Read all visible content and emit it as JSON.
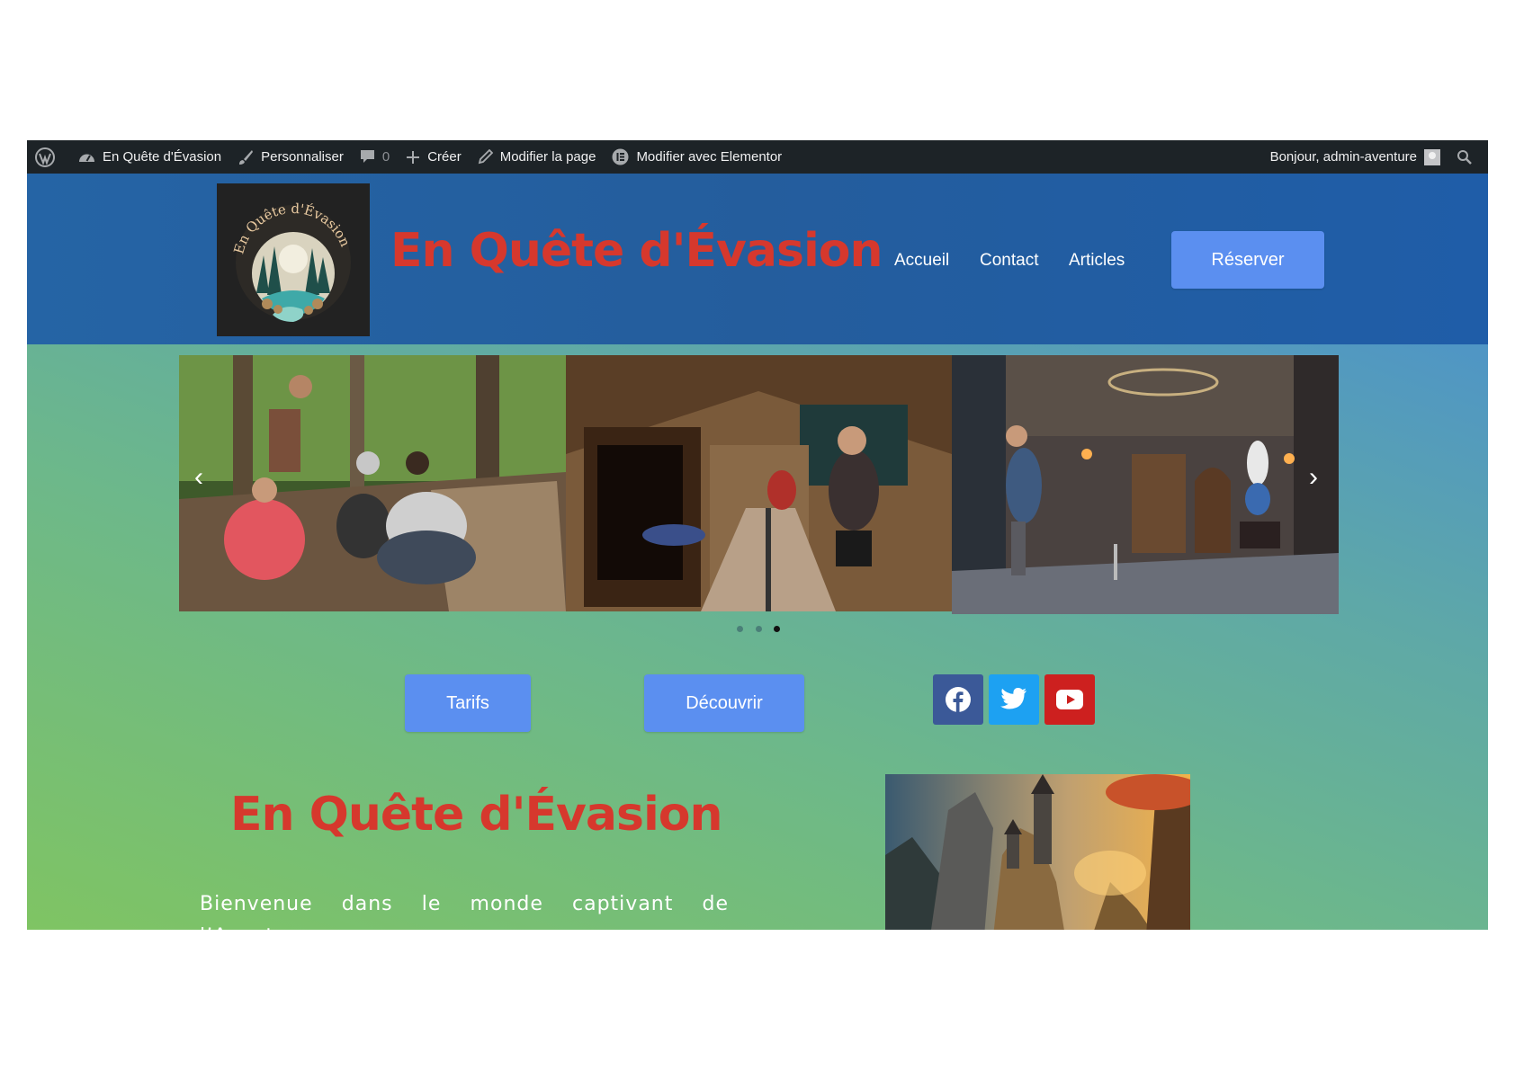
{
  "adminbar": {
    "site_name": "En Quête d'Évasion",
    "customize": "Personnaliser",
    "comments_count": "0",
    "create": "Créer",
    "edit_page": "Modifier la page",
    "edit_elementor": "Modifier avec Elementor",
    "greeting": "Bonjour, admin-aventure",
    "icons": [
      "wordpress-icon",
      "dashboard-icon",
      "brush-icon",
      "comment-icon",
      "plus-icon",
      "pencil-icon",
      "elementor-icon",
      "avatar",
      "search-icon"
    ]
  },
  "header": {
    "logo_text": "En Quête d'Évasion",
    "site_title": "En Quête d'Évasion",
    "nav": [
      "Accueil",
      "Contact",
      "Articles"
    ],
    "cta": "Réserver"
  },
  "slider": {
    "slides": [
      "forest-group-photo",
      "mine-escape-room-photo",
      "dungeon-escape-room-photo"
    ],
    "active_index": 2,
    "total": 3
  },
  "actions": {
    "tarifs": "Tarifs",
    "decouvrir": "Découvrir"
  },
  "social": [
    "facebook-icon",
    "twitter-icon",
    "youtube-icon"
  ],
  "section": {
    "title": "En Quête d'Évasion",
    "intro": "Bienvenue dans le monde captivant de l’Aventure"
  },
  "colors": {
    "adminbar": "#1d2327",
    "header": "#245d9d",
    "title_red": "#d6382d",
    "button_blue": "#5b8ff0",
    "facebook": "#3b5998",
    "twitter": "#1da1f2",
    "youtube": "#cd201f"
  }
}
